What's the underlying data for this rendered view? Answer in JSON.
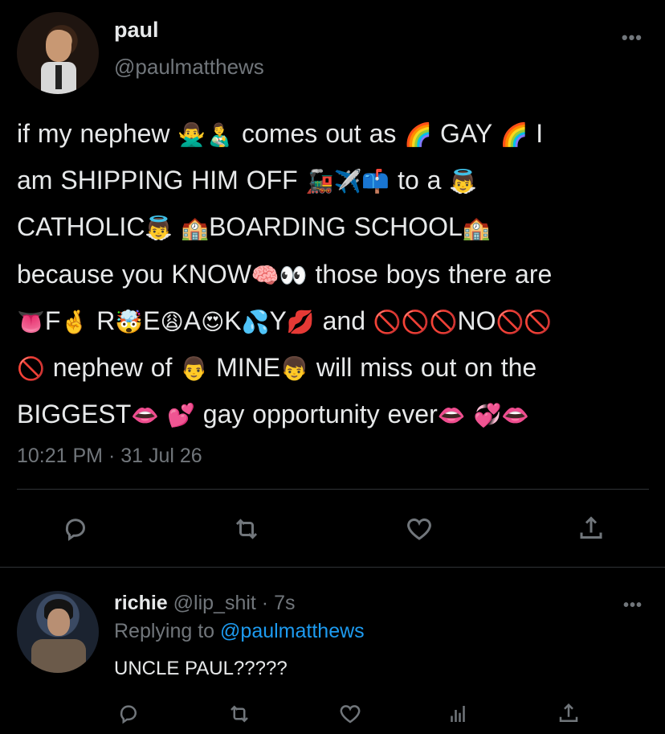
{
  "main_tweet": {
    "name": "paul",
    "handle": "@paulmatthews",
    "more_label": "•••",
    "text_lines": [
      [
        {
          "t": "if my nephew "
        },
        {
          "e": "🙅‍♂️👨‍🍼"
        },
        {
          "t": " comes out as "
        },
        {
          "e": "🌈"
        },
        {
          "t": " GAY "
        },
        {
          "e": "🌈"
        },
        {
          "t": " I"
        }
      ],
      [
        {
          "t": "am SHIPPING HIM OFF "
        },
        {
          "e": "🚂✈️📫"
        },
        {
          "t": " to a "
        },
        {
          "e": "👼"
        }
      ],
      [
        {
          "t": "CATHOLIC"
        },
        {
          "e": "👼 🏫"
        },
        {
          "t": "BOARDING SCHOOL"
        },
        {
          "e": "🏫"
        }
      ],
      [
        {
          "t": "because you KNOW"
        },
        {
          "e": "🧠👀"
        },
        {
          "t": " those boys there are"
        }
      ],
      [
        {
          "e": "👅"
        },
        {
          "t": "F"
        },
        {
          "e": "🤞"
        },
        {
          "t": " R"
        },
        {
          "e": "🤯"
        },
        {
          "t": "E"
        },
        {
          "e": "😩"
        },
        {
          "t": "A"
        },
        {
          "e": "😍"
        },
        {
          "t": "K"
        },
        {
          "e": "💦"
        },
        {
          "t": "Y"
        },
        {
          "e": "💋"
        },
        {
          "t": " and "
        },
        {
          "e": "🚫🚫🚫"
        },
        {
          "t": "NO"
        },
        {
          "e": "🚫🚫"
        }
      ],
      [
        {
          "e": "🚫"
        },
        {
          "t": " nephew of "
        },
        {
          "e": "👨"
        },
        {
          "t": " MINE"
        },
        {
          "e": "👦"
        },
        {
          "t": " will miss out on the"
        }
      ],
      [
        {
          "t": "BIGGEST"
        },
        {
          "e": "👄 💕"
        },
        {
          "t": " gay opportunity ever"
        },
        {
          "e": "👄 💞👄"
        }
      ]
    ],
    "timestamp": "10:21 PM · 31 Jul 26"
  },
  "reply_tweet": {
    "name": "richie",
    "handle": "@lip_shit",
    "time": " · 7s",
    "more_label": "•••",
    "replying_prefix": "Replying to ",
    "replying_mention": "@paulmatthews",
    "text": "UNCLE PAUL?????"
  },
  "icons": {
    "reply": "reply-icon",
    "retweet": "retweet-icon",
    "like": "heart-icon",
    "share": "share-icon",
    "analytics": "analytics-icon"
  },
  "colors": {
    "background": "#000000",
    "text": "#e7e9ea",
    "secondary": "#71767b",
    "accent": "#1d9bf0",
    "divider": "#2f3336"
  }
}
